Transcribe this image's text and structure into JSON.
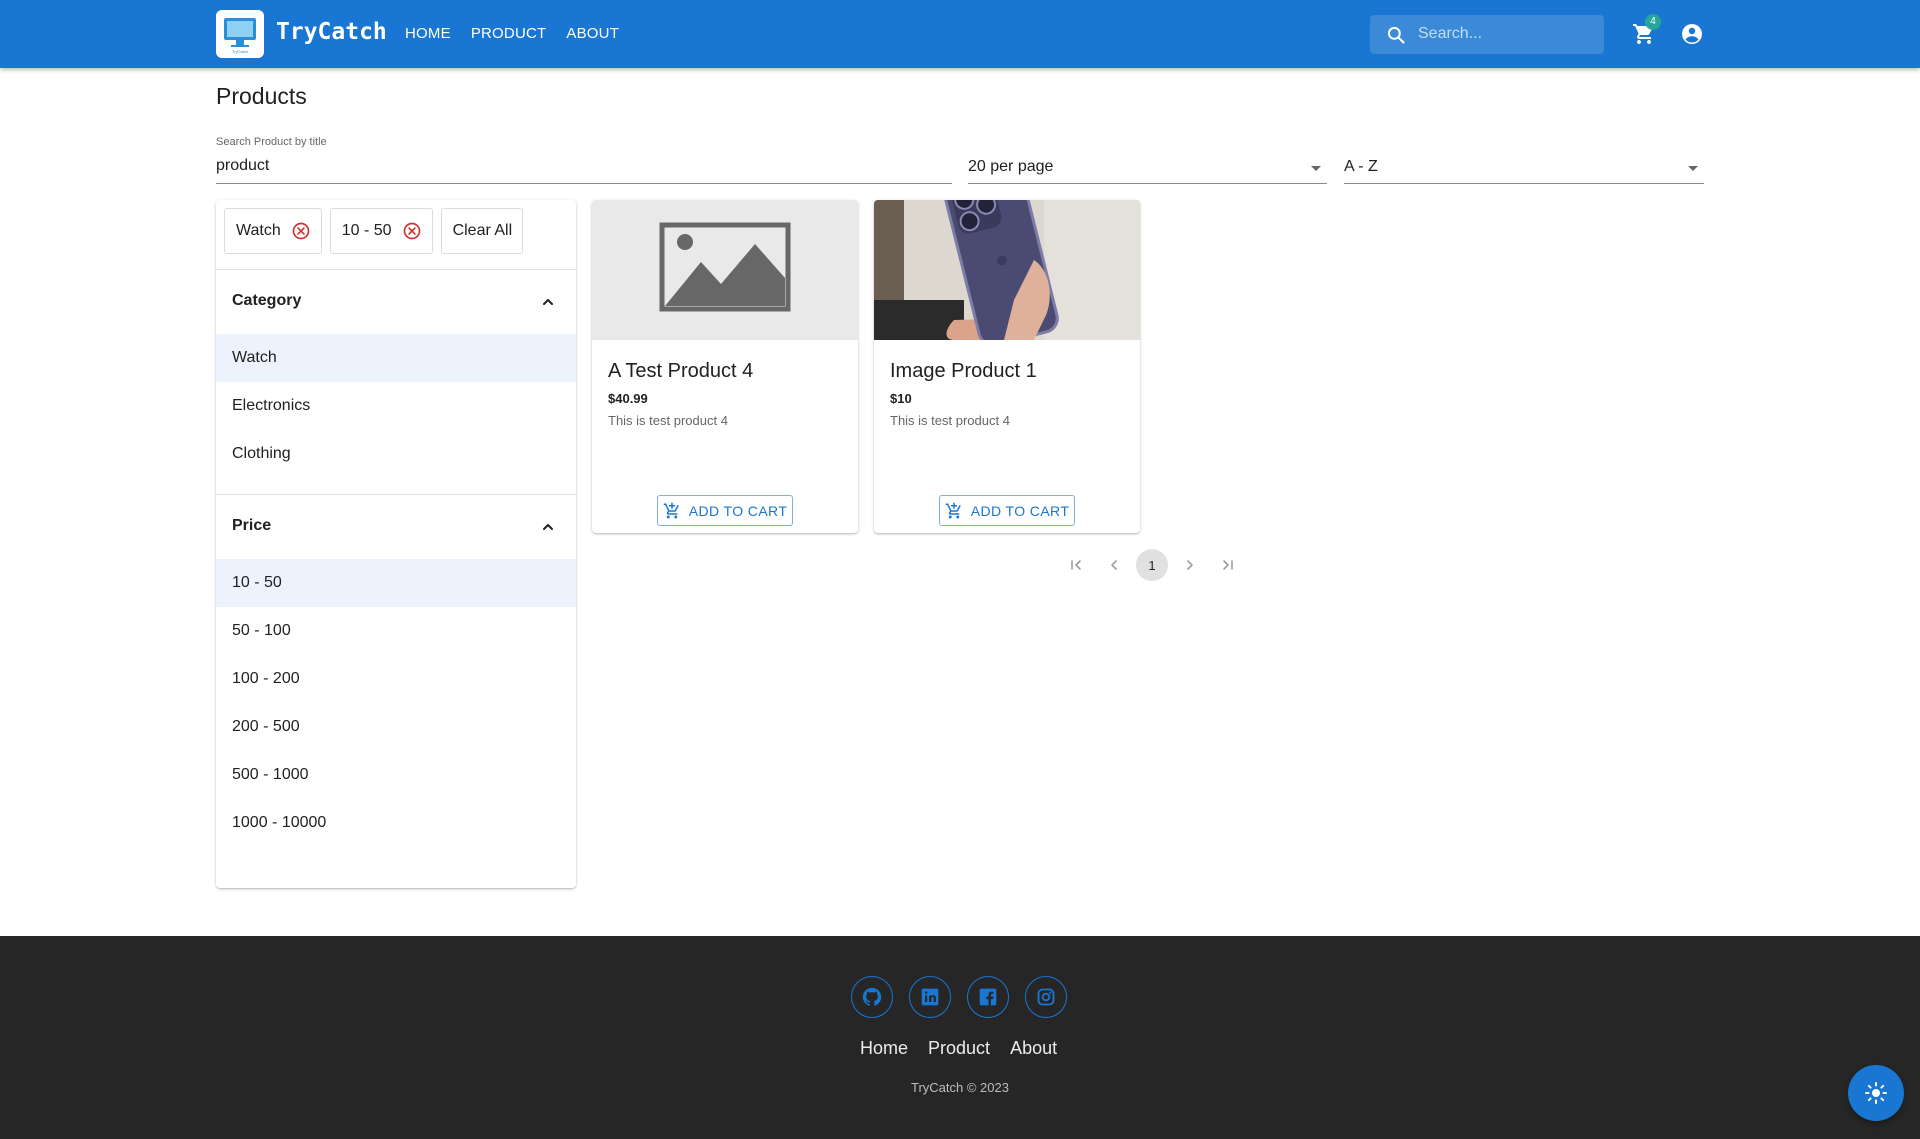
{
  "header": {
    "brand": "TryCatch",
    "logo_caption": "TryCatch",
    "nav": [
      {
        "label": "HOME"
      },
      {
        "label": "PRODUCT"
      },
      {
        "label": "ABOUT"
      }
    ],
    "search_placeholder": "Search...",
    "cart_count": "4",
    "icons": [
      "search-icon",
      "cart-icon",
      "account-icon"
    ],
    "accent_color": "#1976d2"
  },
  "page": {
    "title": "Products",
    "search_label": "Search Product by title",
    "search_value": "product",
    "per_page": "20 per page",
    "sort": "A - Z"
  },
  "filters": {
    "active_chips": [
      {
        "label": "Watch"
      },
      {
        "label": "10 - 50"
      }
    ],
    "clear_all": "Clear All",
    "category": {
      "title": "Category",
      "options": [
        "Watch",
        "Electronics",
        "Clothing"
      ],
      "selected": "Watch"
    },
    "price": {
      "title": "Price",
      "options": [
        "10 - 50",
        "50 - 100",
        "100 - 200",
        "200 - 500",
        "500 - 1000",
        "1000 - 10000"
      ],
      "selected": "10 - 50"
    }
  },
  "products": [
    {
      "name": "A Test Product 4",
      "price": "$40.99",
      "description": "This is test product 4",
      "button": "ADD TO CART",
      "image": "placeholder-image-icon"
    },
    {
      "name": "Image Product 1",
      "price": "$10",
      "description": "This is test product 4",
      "button": "ADD TO CART",
      "image": "phone-photo"
    }
  ],
  "pagination": {
    "current_page": "1",
    "icons": [
      "first-page-icon",
      "prev-page-icon",
      "next-page-icon",
      "last-page-icon"
    ]
  },
  "footer": {
    "socials": [
      "github-icon",
      "linkedin-icon",
      "facebook-icon",
      "instagram-icon"
    ],
    "links": [
      {
        "label": "Home"
      },
      {
        "label": "Product"
      },
      {
        "label": "About"
      }
    ],
    "copyright": "TryCatch © 2023",
    "theme_toggle_icon": "sun-icon"
  }
}
